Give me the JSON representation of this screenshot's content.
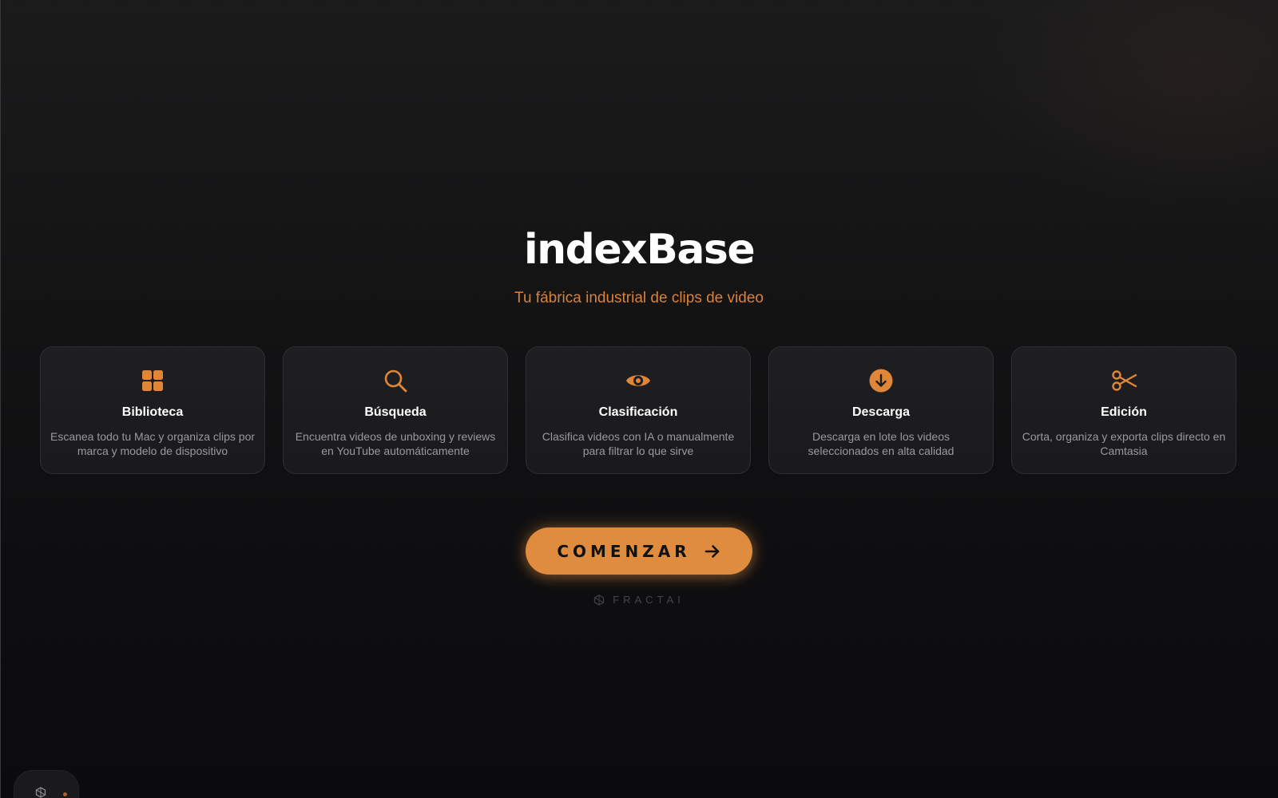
{
  "app": {
    "title": "indexBase",
    "tagline": "Tu fábrica industrial de clips de video"
  },
  "features": [
    {
      "icon": "grid-icon",
      "title": "Biblioteca",
      "description": "Escanea todo tu Mac y organiza clips por marca y modelo de dispositivo"
    },
    {
      "icon": "search-icon",
      "title": "Búsqueda",
      "description": "Encuentra videos de unboxing y reviews en YouTube automáticamente"
    },
    {
      "icon": "eye-icon",
      "title": "Clasificación",
      "description": "Clasifica videos con IA o manualmente para filtrar lo que sirve"
    },
    {
      "icon": "download-circle-icon",
      "title": "Descarga",
      "description": "Descarga en lote los videos seleccionados en alta calidad"
    },
    {
      "icon": "scissors-icon",
      "title": "Edición",
      "description": "Corta, organiza y exporta clips directo en Camtasia"
    }
  ],
  "cta": {
    "label": "COMENZAR",
    "icon": "arrow-right-icon"
  },
  "footer": {
    "brand": "FRACTAI",
    "icon": "fractal-logo-icon"
  },
  "dock": {
    "icon": "fractal-logo-icon",
    "indicator_color": "#b35e2a"
  },
  "colors": {
    "accent": "#df8c3e",
    "tagline": "#d9823b",
    "background": "#111113",
    "card_background": "#1d1d1f"
  }
}
